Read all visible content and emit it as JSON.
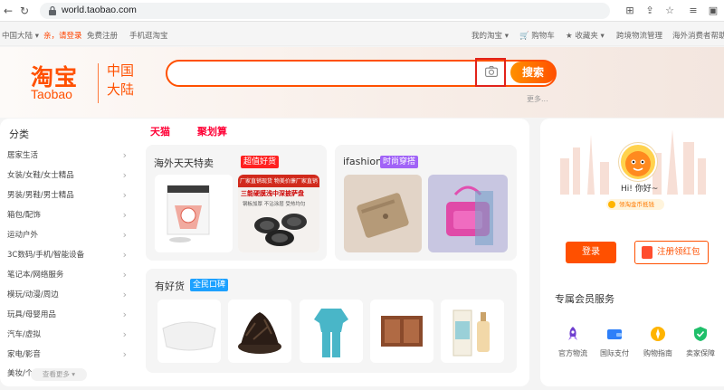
{
  "browser": {
    "url": "world.taobao.com"
  },
  "topbar": {
    "region": "中国大陆",
    "login_prompt": "亲，请登录",
    "register": "免费注册",
    "mobile": "手机逛淘宝",
    "my_taobao": "我的淘宝",
    "cart": "购物车",
    "favorites": "收藏夹",
    "logistics": "跨境物流管理",
    "consumer_help": "海外消费者帮助"
  },
  "header": {
    "logo_cn": "淘宝",
    "logo_en": "Taobao",
    "region_line1": "中国",
    "region_line2": "大陆",
    "search_button": "搜索",
    "more": "更多..."
  },
  "categories": {
    "title": "分类",
    "items": [
      "居家生活",
      "女装/女鞋/女士精品",
      "男装/男鞋/男士精品",
      "箱包/配饰",
      "运动户外",
      "3C数码/手机/智能设备",
      "笔记本/网络服务",
      "模玩/动漫/周边",
      "玩具/母婴用品",
      "汽车/虚拟",
      "家电/影音",
      "美妆/个"
    ],
    "see_more": "查看更多"
  },
  "tabs": {
    "tmall": "天猫",
    "juhuasuan": "聚划算"
  },
  "sections": {
    "overseas": {
      "title": "海外天天特卖",
      "badge": "超值好货"
    },
    "ifashion": {
      "title": "ifashion",
      "badge": "时尚穿搭"
    },
    "goods": {
      "title": "有好货",
      "badge": "全民口碑"
    }
  },
  "products": {
    "product_2_line1": "三能硬膜浅中深披萨盘",
    "product_2_line2": "厂家直销现货 物美价廉厂家直销",
    "product_2_line3": "钢板加厚 不沾涂层 受热均匀"
  },
  "user_panel": {
    "greeting": "Hi! 你好~",
    "coins": "领淘金币抵钱",
    "login": "登录",
    "register_red": "注册领红包",
    "services_title": "专属会员服务",
    "services": [
      "官方物流",
      "国际支付",
      "购物指南",
      "卖家保障"
    ]
  },
  "colors": {
    "brand": "#ff5000",
    "tmall": "#ff0036",
    "badge_overseas": "#ff2020",
    "badge_fashion": "#a163f7",
    "badge_goods": "#1da1ff"
  }
}
